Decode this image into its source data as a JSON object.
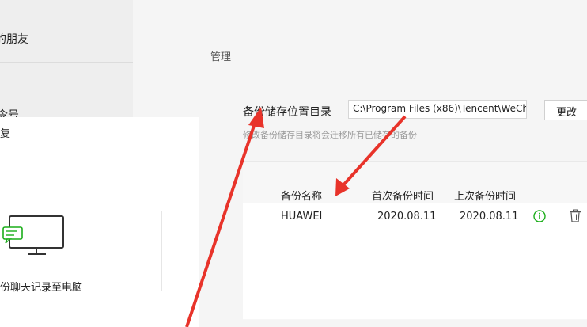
{
  "sidebar": {
    "item_top": "的朋友",
    "item_bottom": "令号"
  },
  "settings": {
    "section_title": "管理",
    "backup_dir_label": "备份储存位置目录",
    "backup_dir_value": "C:\\Program Files (x86)\\Tencent\\WeCh",
    "change_button": "更改",
    "hint": "修改备份储存目录将会迁移所有已储存的备份"
  },
  "backup_table": {
    "columns": [
      "备份名称",
      "首次备份时间",
      "上次备份时间"
    ],
    "rows": [
      {
        "name": "HUAWEI",
        "first": "2020.08.11",
        "last": "2020.08.11"
      }
    ]
  },
  "dialog": {
    "title": "复",
    "option_label": "份聊天记录至电脑"
  },
  "colors": {
    "accent_green": "#1aad19",
    "annotation_red": "#e8332a"
  },
  "icons": [
    "info-icon",
    "trash-icon",
    "computer-icon"
  ]
}
